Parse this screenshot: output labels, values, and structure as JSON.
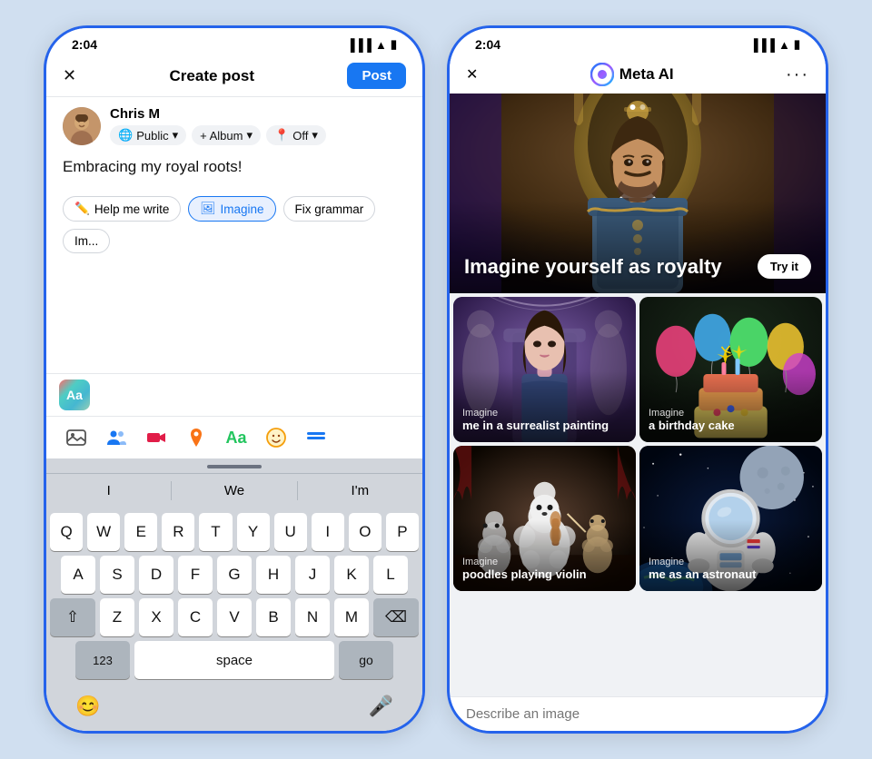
{
  "background": "#d0dff0",
  "phone1": {
    "status_time": "2:04",
    "header_title": "Create post",
    "close_label": "✕",
    "post_button": "Post",
    "user_name": "Chris M",
    "visibility": "Public",
    "album": "+ Album",
    "location_status": "Off",
    "post_text": "Embracing my royal roots!",
    "ai_suggestions": [
      {
        "label": "Help me write",
        "icon": "✏️",
        "selected": false
      },
      {
        "label": "Imagine",
        "icon": "🖼",
        "selected": true
      },
      {
        "label": "Fix grammar",
        "icon": "",
        "selected": false
      },
      {
        "label": "Im...",
        "icon": "",
        "selected": false
      }
    ],
    "keyboard": {
      "predictive": [
        "I",
        "We",
        "I'm"
      ],
      "rows": [
        [
          "Q",
          "W",
          "E",
          "R",
          "T",
          "Y",
          "U",
          "I",
          "O",
          "P"
        ],
        [
          "A",
          "S",
          "D",
          "F",
          "G",
          "H",
          "J",
          "K",
          "L"
        ],
        [
          "⇧",
          "Z",
          "X",
          "C",
          "V",
          "B",
          "N",
          "M",
          "⌫"
        ],
        [
          "123",
          "space",
          "go"
        ]
      ]
    }
  },
  "phone2": {
    "status_time": "2:04",
    "title": "Meta AI",
    "close_label": "✕",
    "dots_menu": "···",
    "main_card": {
      "title": "Imagine yourself as royalty",
      "try_it_label": "Try it"
    },
    "grid_cards": [
      {
        "label_small": "Imagine",
        "label_main": "me in a surrealist painting",
        "type": "surrealist"
      },
      {
        "label_small": "Imagine",
        "label_main": "a birthday cake",
        "type": "birthday"
      },
      {
        "label_small": "Imagine",
        "label_main": "poodles playing violin",
        "type": "poodles"
      },
      {
        "label_small": "Imagine",
        "label_main": "me as an astronaut",
        "type": "astronaut"
      }
    ],
    "describe_placeholder": "Describe an image"
  }
}
